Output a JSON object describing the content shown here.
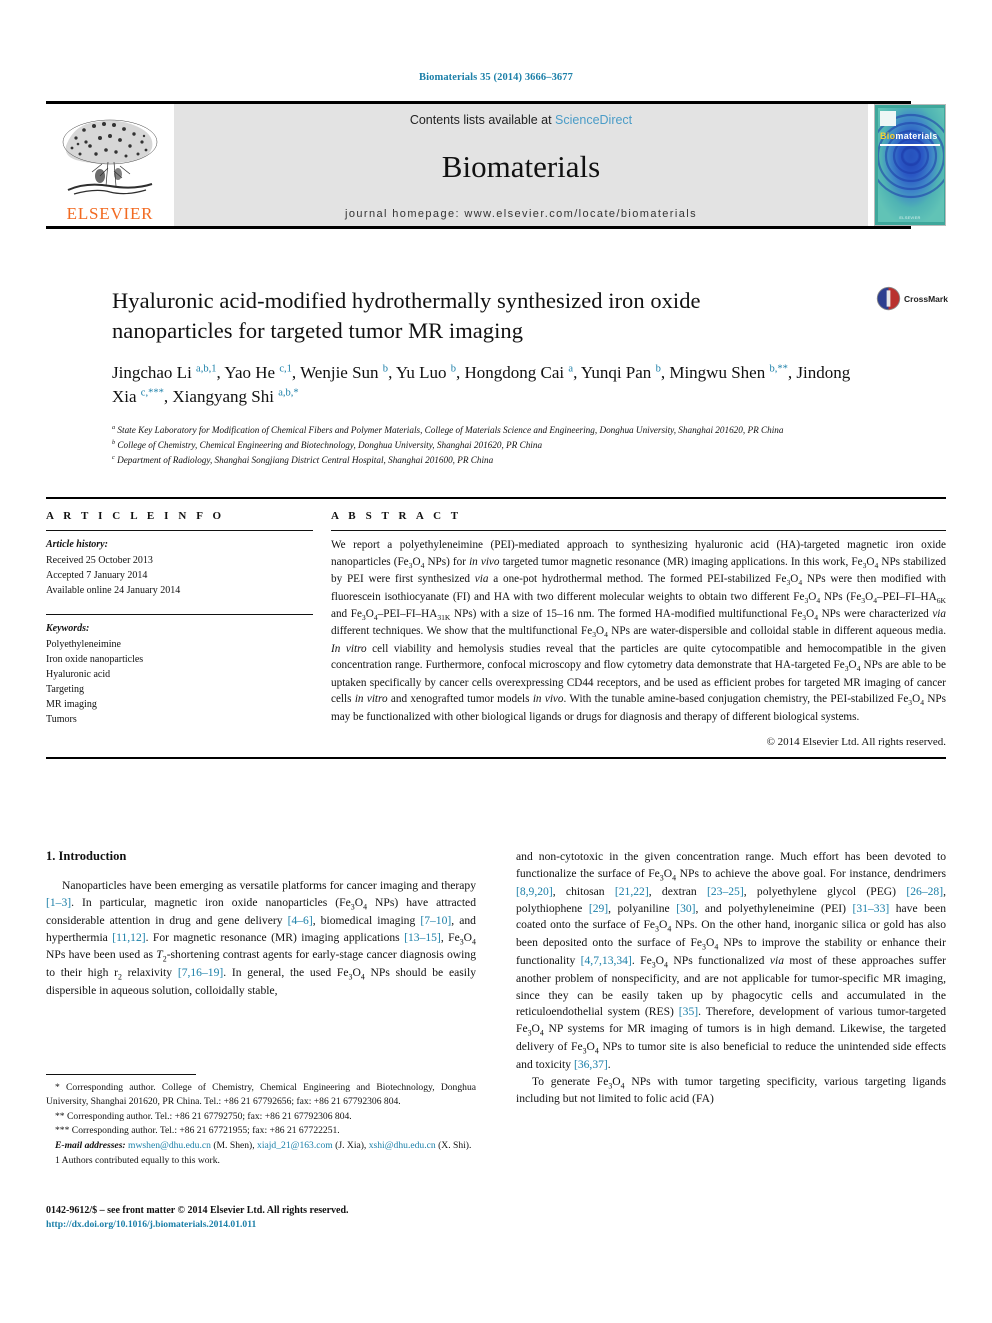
{
  "running_head": "Biomaterials 35 (2014) 3666–3677",
  "masthead": {
    "contents_prefix": "Contents lists available at ",
    "sciencedirect": "ScienceDirect",
    "journal_name": "Biomaterials",
    "homepage": "journal homepage: www.elsevier.com/locate/biomaterials",
    "publisher": "ELSEVIER",
    "cover": {
      "title_bold": "Bio",
      "title_rest": "materials",
      "footer": "ELSEVIER"
    }
  },
  "article": {
    "title_line1": "Hyaluronic acid-modified hydrothermally synthesized iron oxide",
    "title_line2": "nanoparticles for targeted tumor MR imaging",
    "authors_html": "Jingchao Li <sup>a,b,1</sup>, Yao He <sup>c,1</sup>, Wenjie Sun <sup>b</sup>, Yu Luo <sup>b</sup>, Hongdong Cai <sup>a</sup>, Yunqi Pan <sup>b</sup>, Mingwu Shen <sup>b,**</sup>, Jindong Xia <sup>c,***</sup>, Xiangyang Shi <sup>a,b,*</sup>",
    "affiliations": [
      "a State Key Laboratory for Modification of Chemical Fibers and Polymer Materials, College of Materials Science and Engineering, Donghua University, Shanghai 201620, PR China",
      "b College of Chemistry, Chemical Engineering and Biotechnology, Donghua University, Shanghai 201620, PR China",
      "c Department of Radiology, Shanghai Songjiang District Central Hospital, Shanghai 201600, PR China"
    ],
    "crossmark_label": "CrossMark"
  },
  "info": {
    "heading": "A R T I C L E   I N F O",
    "history_label": "Article history:",
    "history": [
      "Received 25 October 2013",
      "Accepted 7 January 2014",
      "Available online 24 January 2014"
    ],
    "keywords_label": "Keywords:",
    "keywords": [
      "Polyethyleneimine",
      "Iron oxide nanoparticles",
      "Hyaluronic acid",
      "Targeting",
      "MR imaging",
      "Tumors"
    ]
  },
  "abstract": {
    "heading": "A B S T R A C T",
    "body_html": "We report a polyethyleneimine (PEI)-mediated approach to synthesizing hyaluronic acid (HA)-targeted magnetic iron oxide nanoparticles (Fe<sub>3</sub>O<sub>4</sub> NPs) for <i>in vivo</i> targeted tumor magnetic resonance (MR) imaging applications. In this work, Fe<sub>3</sub>O<sub>4</sub> NPs stabilized by PEI were first synthesized <i>via</i> a one-pot hydrothermal method. The formed PEI-stabilized Fe<sub>3</sub>O<sub>4</sub> NPs were then modified with fluorescein isothiocyanate (FI) and HA with two different molecular weights to obtain two different Fe<sub>3</sub>O<sub>4</sub> NPs (Fe<sub>3</sub>O<sub>4</sub>–PEI–FI–HA<sub>6K</sub> and Fe<sub>3</sub>O<sub>4</sub>–PEI–FI–HA<sub>31K</sub> NPs) with a size of 15–16 nm. The formed HA-modified multifunctional Fe<sub>3</sub>O<sub>4</sub> NPs were characterized <i>via</i> different techniques. We show that the multifunctional Fe<sub>3</sub>O<sub>4</sub> NPs are water-dispersible and colloidal stable in different aqueous media. <i>In vitro</i> cell viability and hemolysis studies reveal that the particles are quite cytocompatible and hemocompatible in the given concentration range. Furthermore, confocal microscopy and flow cytometry data demonstrate that HA-targeted Fe<sub>3</sub>O<sub>4</sub> NPs are able to be uptaken specifically by cancer cells overexpressing CD44 receptors, and be used as efficient probes for targeted MR imaging of cancer cells <i>in vitro</i> and xenografted tumor models <i>in vivo</i>. With the tunable amine-based conjugation chemistry, the PEI-stabilized Fe<sub>3</sub>O<sub>4</sub> NPs may be functionalized with other biological ligands or drugs for diagnosis and therapy of different biological systems.",
    "copyright": "© 2014 Elsevier Ltd. All rights reserved."
  },
  "introduction": {
    "heading": "1.  Introduction",
    "left_paragraph_html": "Nanoparticles have been emerging as versatile platforms for cancer imaging and therapy <span class=\"ref\">[1–3]</span>. In particular, magnetic iron oxide nanoparticles (Fe<sub>3</sub>O<sub>4</sub> NPs) have attracted considerable attention in drug and gene delivery <span class=\"ref\">[4–6]</span>, biomedical imaging <span class=\"ref\">[7–10]</span>, and hyperthermia <span class=\"ref\">[11,12]</span>. For magnetic resonance (MR) imaging applications <span class=\"ref\">[13–15]</span>, Fe<sub>3</sub>O<sub>4</sub> NPs have been used as <i>T</i><sub>2</sub>-shortening contrast agents for early-stage cancer diagnosis owing to their high r<sub>2</sub> relaxivity <span class=\"ref\">[7,16–19]</span>. In general, the used Fe<sub>3</sub>O<sub>4</sub> NPs should be easily dispersible in aqueous solution, colloidally stable,",
    "right_paragraph1_html": "and non-cytotoxic in the given concentration range. Much effort has been devoted to functionalize the surface of Fe<sub>3</sub>O<sub>4</sub> NPs to achieve the above goal. For instance, dendrimers <span class=\"ref\">[8,9,20]</span>, chitosan <span class=\"ref\">[21,22]</span>, dextran <span class=\"ref\">[23–25]</span>, polyethylene glycol (PEG) <span class=\"ref\">[26–28]</span>, polythiophene <span class=\"ref\">[29]</span>, polyaniline <span class=\"ref\">[30]</span>, and polyethyleneimine (PEI) <span class=\"ref\">[31–33]</span> have been coated onto the surface of Fe<sub>3</sub>O<sub>4</sub> NPs. On the other hand, inorganic silica or gold has also been deposited onto the surface of Fe<sub>3</sub>O<sub>4</sub> NPs to improve the stability or enhance their functionality <span class=\"ref\">[4,7,13,34]</span>. Fe<sub>3</sub>O<sub>4</sub> NPs functionalized <i>via</i> most of these approaches suffer another problem of nonspecificity, and are not applicable for tumor-specific MR imaging, since they can be easily taken up by phagocytic cells and accumulated in the reticuloendothelial system (RES) <span class=\"ref\">[35]</span>. Therefore, development of various tumor-targeted Fe<sub>3</sub>O<sub>4</sub> NP systems for MR imaging of tumors is in high demand. Likewise, the targeted delivery of Fe<sub>3</sub>O<sub>4</sub> NPs to tumor site is also beneficial to reduce the unintended side effects and toxicity <span class=\"ref\">[36,37]</span>.",
    "right_paragraph2_html": "To generate Fe<sub>3</sub>O<sub>4</sub> NPs with tumor targeting specificity, various targeting ligands including but not limited to folic acid (FA)"
  },
  "footnotes": {
    "items_html": [
      "* Corresponding author. College of Chemistry, Chemical Engineering and Biotechnology, Donghua University, Shanghai 201620, PR China. Tel.: +86 21 67792656; fax: +86 21 67792306 804.",
      "** Corresponding author. Tel.: +86 21 67792750; fax: +86 21 67792306 804.",
      "*** Corresponding author. Tel.: +86 21 67721955; fax: +86 21 67722251."
    ],
    "email_label": "E-mail addresses:",
    "emails_html": "<span class=\"link\">mwshen@dhu.edu.cn</span> (M. Shen), <span class=\"link\">xiajd_21@163.com</span> (J. Xia), <span class=\"link\">xshi@dhu.edu.cn</span> (X. Shi).",
    "equal_contrib": "1  Authors contributed equally to this work."
  },
  "imprint": {
    "front_matter": "0142-9612/$ – see front matter © 2014 Elsevier Ltd. All rights reserved.",
    "doi": "http://dx.doi.org/10.1016/j.biomaterials.2014.01.011"
  },
  "colors": {
    "link_blue": "#1b7fa8",
    "elsevier_orange": "#F26A21",
    "masthead_grey": "#e3e3e3",
    "cover_teal": "#3ea79b"
  }
}
